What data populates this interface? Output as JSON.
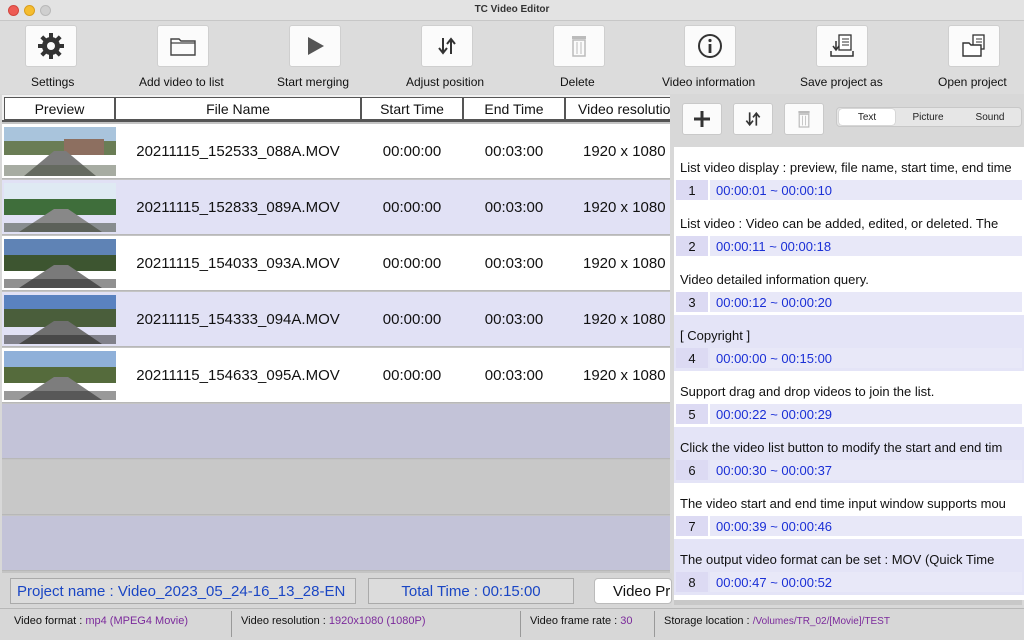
{
  "window": {
    "title": "TC Video Editor"
  },
  "toolbar": {
    "settings": "Settings",
    "add_video": "Add video to list",
    "start_merging": "Start merging",
    "adjust_position": "Adjust position",
    "delete": "Delete",
    "video_information": "Video information",
    "save_project_as": "Save project as",
    "open_project": "Open project"
  },
  "table": {
    "headers": [
      "Preview",
      "File Name",
      "Start Time",
      "End Time",
      "Video resolutio"
    ],
    "rows": [
      {
        "file": "20211115_152533_088A.MOV",
        "start": "00:00:00",
        "end": "00:03:00",
        "resolution": "1920 x 1080"
      },
      {
        "file": "20211115_152833_089A.MOV",
        "start": "00:00:00",
        "end": "00:03:00",
        "resolution": "1920 x 1080"
      },
      {
        "file": "20211115_154033_093A.MOV",
        "start": "00:00:00",
        "end": "00:03:00",
        "resolution": "1920 x 1080"
      },
      {
        "file": "20211115_154333_094A.MOV",
        "start": "00:00:00",
        "end": "00:03:00",
        "resolution": "1920 x 1080"
      },
      {
        "file": "20211115_154633_095A.MOV",
        "start": "00:00:00",
        "end": "00:03:00",
        "resolution": "1920 x 1080"
      }
    ]
  },
  "project": {
    "name": "Project name : Video_2023_05_24-16_13_28-EN",
    "total_time": "Total Time : 00:15:00",
    "preview_button": "Video Pr"
  },
  "status": {
    "format_label": "Video format :",
    "format_value": "mp4 (MPEG4 Movie)",
    "resolution_label": "Video resolution :",
    "resolution_value": "1920x1080 (1080P)",
    "framerate_label": "Video frame rate :",
    "framerate_value": "30",
    "storage_label": "Storage location :",
    "storage_value": "/Volumes/TR_02/[Movie]/TEST"
  },
  "right": {
    "tabs": [
      "Text",
      "Picture",
      "Sound"
    ],
    "active_tab": "Text",
    "items": [
      {
        "text": "List video display : preview, file name, start time, end time",
        "num": "1",
        "time": "00:00:01 ~ 00:00:10"
      },
      {
        "text": "List video : Video can be added, edited, or deleted. The",
        "num": "2",
        "time": "00:00:11 ~ 00:00:18"
      },
      {
        "text": "Video detailed information query.",
        "num": "3",
        "time": "00:00:12 ~ 00:00:20"
      },
      {
        "text": "[ Copyright ]",
        "num": "4",
        "time": "00:00:00 ~ 00:15:00"
      },
      {
        "text": "Support drag and drop videos to join the list.",
        "num": "5",
        "time": "00:00:22 ~ 00:00:29"
      },
      {
        "text": "Click the video list button to modify the start and end tim",
        "num": "6",
        "time": "00:00:30 ~ 00:00:37"
      },
      {
        "text": "The video start and end time input window supports mou",
        "num": "7",
        "time": "00:00:39 ~ 00:00:46"
      },
      {
        "text": "The output video format can be set : MOV (Quick Time",
        "num": "8",
        "time": "00:00:47 ~ 00:00:52"
      }
    ]
  }
}
